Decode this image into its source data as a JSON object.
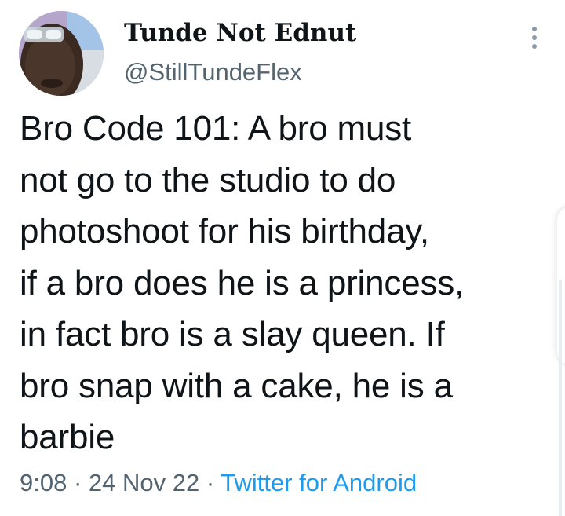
{
  "user": {
    "display_name": "Tunde Not Ednut",
    "handle": "@StillTundeFlex"
  },
  "tweet": {
    "text": "Bro Code 101: A bro must\nnot go to the studio to do\nphotoshoot for his birthday,\nif a bro does he is a princess,\nin fact bro is a slay queen. If\nbro snap with a cake, he is a\nbarbie",
    "time": "9:08",
    "date": "24 Nov 22",
    "separator": "·",
    "source": "Twitter for Android"
  },
  "icons": {
    "more": "more-vertical-icon"
  },
  "colors": {
    "text_primary": "#0f1419",
    "text_secondary": "#536471",
    "link": "#1d9bf0"
  }
}
